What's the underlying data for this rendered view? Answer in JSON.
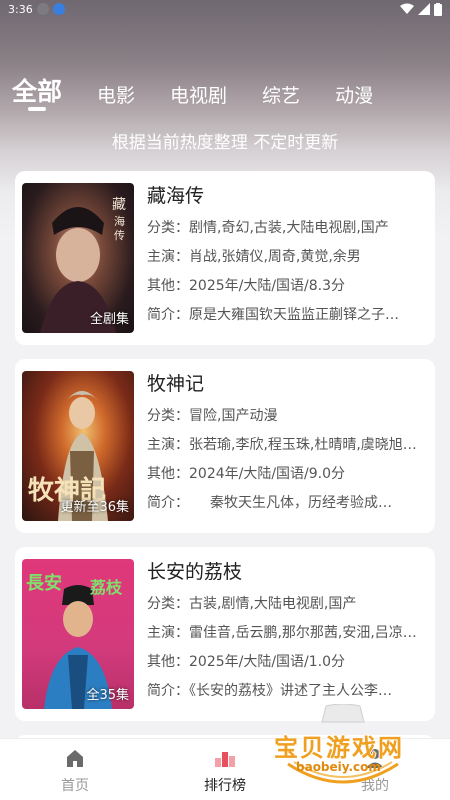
{
  "status": {
    "time": "3:36"
  },
  "tabs": [
    {
      "label": "全部",
      "active": true
    },
    {
      "label": "电影"
    },
    {
      "label": "电视剧"
    },
    {
      "label": "综艺"
    },
    {
      "label": "动漫"
    }
  ],
  "subtitle": "根据当前热度整理 不定时更新",
  "cards": [
    {
      "title": "藏海传",
      "badge": "全剧集",
      "genre": "分类：剧情,奇幻,古装,大陆电视剧,国产",
      "cast": "主演：肖战,张婧仪,周奇,黄觉,余男",
      "other": "其他：2025年/大陆/国语/8.3分",
      "intro": "简介：原是大雍国钦天监监正蒯铎之子…"
    },
    {
      "title": "牧神记",
      "badge": "更新至36集",
      "genre": "分类：冒险,国产动漫",
      "cast": "主演：张若瑜,李欣,程玉珠,杜晴晴,虞晓旭…",
      "other": "其他：2024年/大陆/国语/9.0分",
      "intro": "简介：　　秦牧天生凡体，历经考验成…"
    },
    {
      "title": "长安的荔枝",
      "badge": "全35集",
      "genre": "分类：古装,剧情,大陆电视剧,国产",
      "cast": "主演：雷佳音,岳云鹏,那尔那茜,安沺,吕凉…",
      "other": "其他：2025年/大陆/国语/1.0分",
      "intro": "简介：《长安的荔枝》讲述了主人公李…"
    }
  ],
  "nav": [
    {
      "label": "首页",
      "icon": "home-icon"
    },
    {
      "label": "排行榜",
      "icon": "ranking-icon",
      "active": true
    },
    {
      "label": "我的",
      "icon": "profile-icon"
    }
  ],
  "watermark": {
    "text": "宝贝游戏网",
    "domain": "baobeiy.com"
  },
  "colors": {
    "accent": "#ffffff",
    "nav_active": "#222222",
    "nav_inactive": "#999999",
    "watermark": "#f0a020"
  }
}
